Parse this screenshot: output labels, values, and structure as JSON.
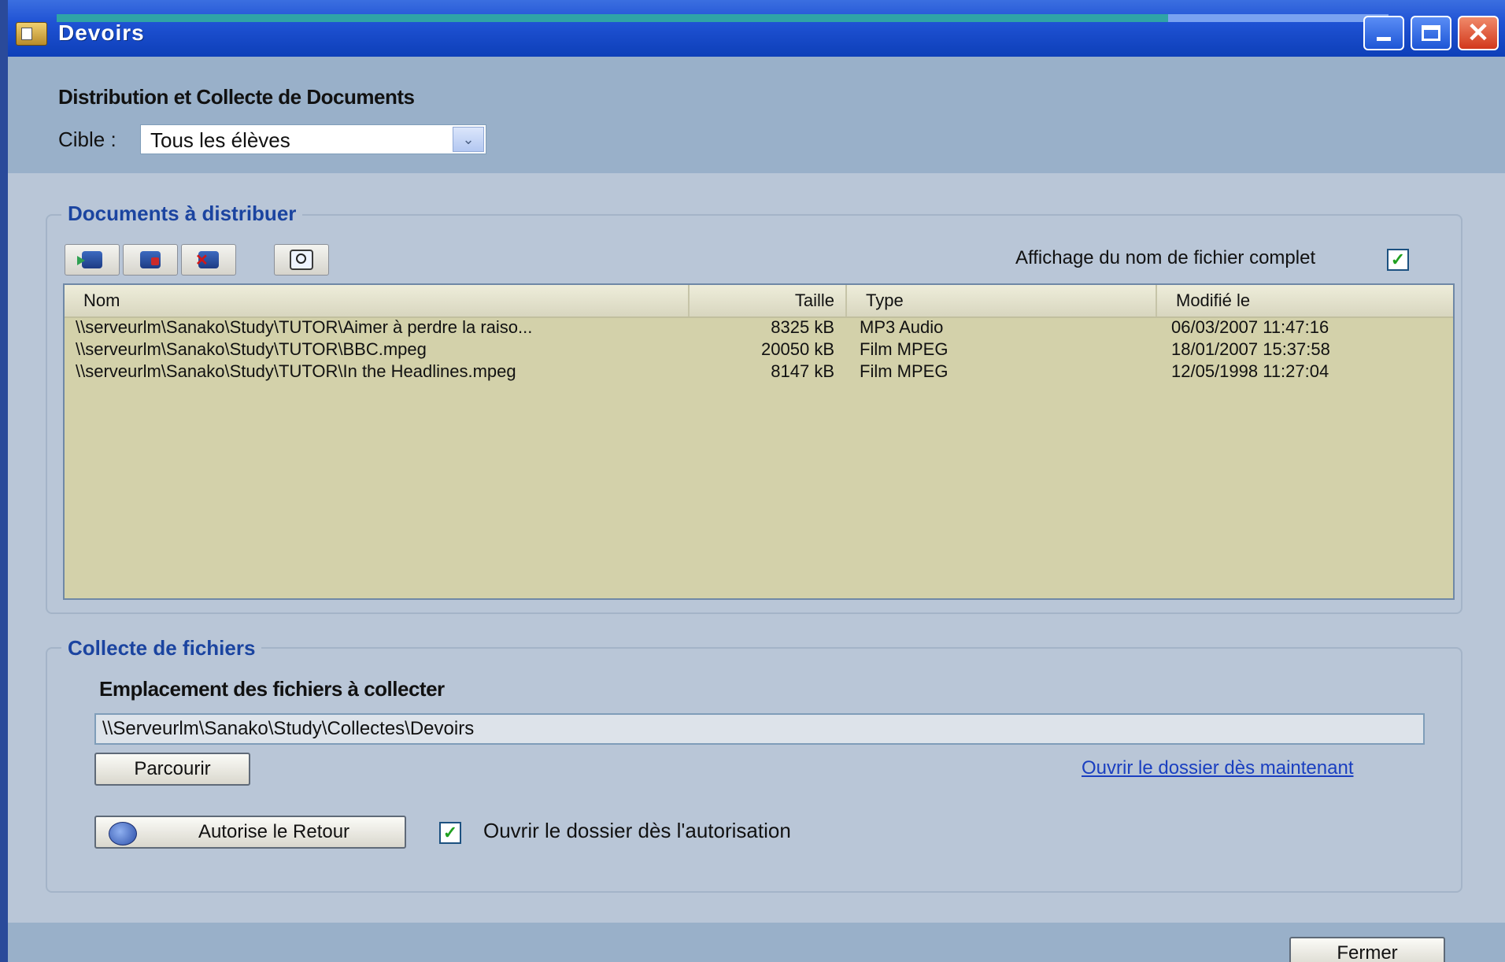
{
  "window": {
    "title": "Devoirs",
    "close_symbol": "✕"
  },
  "dialog": {
    "title": "Distribution et Collecte de Documents",
    "cible_label": "Cible :",
    "cible_value": "Tous les élèves",
    "combo_arrow": "⌄"
  },
  "documents": {
    "legend": "Documents à distribuer",
    "fullname_label": "Affichage du nom de fichier complet",
    "fullname_checked": true,
    "check_symbol": "✓",
    "columns": [
      "Nom",
      "Taille",
      "Type",
      "Modifié le"
    ],
    "rows": [
      {
        "nom": "\\\\serveurlm\\Sanako\\Study\\TUTOR\\Aimer à perdre la raiso...",
        "taille": "8325 kB",
        "type": "MP3 Audio",
        "modifie": "06/03/2007 11:47:16"
      },
      {
        "nom": "\\\\serveurlm\\Sanako\\Study\\TUTOR\\BBC.mpeg",
        "taille": "20050 kB",
        "type": "Film MPEG",
        "modifie": "18/01/2007 15:37:58"
      },
      {
        "nom": "\\\\serveurlm\\Sanako\\Study\\TUTOR\\In the Headlines.mpeg",
        "taille": "8147 kB",
        "type": "Film MPEG",
        "modifie": "12/05/1998 11:27:04"
      }
    ]
  },
  "collect": {
    "legend": "Collecte de fichiers",
    "location_label": "Emplacement des fichiers à collecter",
    "location_value": "\\\\Serveurlm\\Sanako\\Study\\Collectes\\Devoirs",
    "browse_button": "Parcourir",
    "open_now_link": "Ouvrir le dossier dès maintenant",
    "authorize_button": "Autorise le Retour",
    "open_on_auth_label": "Ouvrir le dossier dès l'autorisation",
    "open_on_auth_checked": true
  },
  "footer": {
    "close_button": "Fermer"
  }
}
